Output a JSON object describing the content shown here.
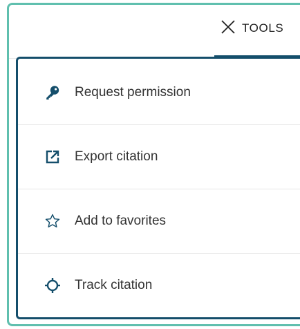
{
  "header": {
    "tools_label": "TOOLS"
  },
  "menu": {
    "items": [
      {
        "label": "Request permission",
        "icon": "key-icon"
      },
      {
        "label": "Export citation",
        "icon": "external-link-icon"
      },
      {
        "label": "Add to favorites",
        "icon": "star-icon"
      },
      {
        "label": "Track citation",
        "icon": "crosshair-icon"
      }
    ]
  },
  "colors": {
    "frame_accent": "#5fbfae",
    "brand_navy": "#144e6b",
    "text": "#333333"
  }
}
